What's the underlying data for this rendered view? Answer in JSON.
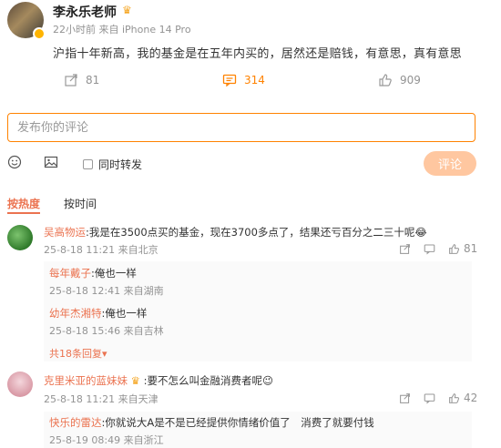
{
  "post": {
    "author": "李永乐老师",
    "meta": "22小时前 来自 iPhone 14 Pro",
    "body": "沪指十年新高，我的基金是在五年内买的，居然还是赔钱，有意思，真有意思",
    "repost_count": "81",
    "comment_count": "314",
    "like_count": "909"
  },
  "composer": {
    "placeholder": "发布你的评论",
    "repost_label": "同时转发",
    "submit_label": "评论"
  },
  "sort": {
    "hot": "按热度",
    "time": "按时间"
  },
  "comments": [
    {
      "user": "吴高物运",
      "text": ":我是在3500点买的基金，现在3700多点了，结果还亏百分之二三十呢😂",
      "meta": "25-8-18 11:21 来自北京",
      "likes": "81",
      "replies": [
        {
          "user": "每年戴子",
          "text": ":俺也一样",
          "meta": "25-8-18 12:41 来自湖南"
        },
        {
          "user": "幼年杰湘特",
          "text": ":俺也一样",
          "meta": "25-8-18 15:46 来自吉林"
        }
      ],
      "more_replies": "共18条回复"
    },
    {
      "user": "克里米亚的蓝妹妹",
      "text": ":要不怎么叫金融消费者呢😉",
      "meta": "25-8-18 11:21 来自天津",
      "likes": "42",
      "replies": [
        {
          "user": "快乐的雷达",
          "text": ":你就说大A是不是已经提供你情绪价值了　消费了就要付钱",
          "meta": "25-8-19 08:49 来自浙江"
        }
      ]
    }
  ],
  "colors": {
    "accent": "#eb7350",
    "brand": "#ff8200"
  }
}
